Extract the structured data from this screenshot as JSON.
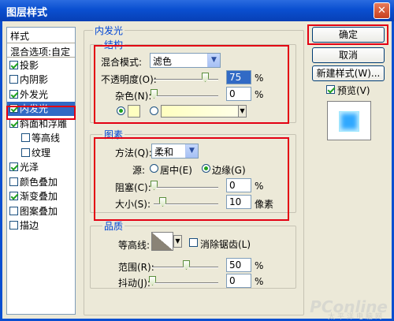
{
  "window": {
    "title": "图层样式",
    "close_glyph": "✕"
  },
  "sidebar": {
    "header": "样式",
    "blend_options": "混合选项:自定",
    "items": [
      {
        "label": "投影",
        "checked": true,
        "sub": false,
        "selected": false
      },
      {
        "label": "内阴影",
        "checked": false,
        "sub": false,
        "selected": false
      },
      {
        "label": "外发光",
        "checked": true,
        "sub": false,
        "selected": false
      },
      {
        "label": "内发光",
        "checked": true,
        "sub": false,
        "selected": true
      },
      {
        "label": "斜面和浮雕",
        "checked": true,
        "sub": false,
        "selected": false
      },
      {
        "label": "等高线",
        "checked": false,
        "sub": true,
        "selected": false
      },
      {
        "label": "纹理",
        "checked": false,
        "sub": true,
        "selected": false
      },
      {
        "label": "光泽",
        "checked": true,
        "sub": false,
        "selected": false
      },
      {
        "label": "颜色叠加",
        "checked": false,
        "sub": false,
        "selected": false
      },
      {
        "label": "渐变叠加",
        "checked": true,
        "sub": false,
        "selected": false
      },
      {
        "label": "图案叠加",
        "checked": false,
        "sub": false,
        "selected": false
      },
      {
        "label": "描边",
        "checked": false,
        "sub": false,
        "selected": false
      }
    ]
  },
  "panel": {
    "title": "内发光",
    "structure": {
      "title": "结构",
      "blend_mode_label": "混合模式:",
      "blend_mode_value": "滤色",
      "opacity_label": "不透明度(O):",
      "opacity_value": "75",
      "opacity_unit": "%",
      "opacity_level": 0.75,
      "noise_label": "杂色(N):",
      "noise_value": "0",
      "noise_unit": "%",
      "color_swatch": "#ffffc0"
    },
    "elements": {
      "title": "图素",
      "method_label": "方法(Q):",
      "method_value": "柔和",
      "source_label": "源:",
      "source_center": "居中(E)",
      "source_edge": "边缘(G)",
      "choke_label": "阻塞(C):",
      "choke_value": "0",
      "choke_unit": "%",
      "size_label": "大小(S):",
      "size_value": "10",
      "size_unit": "像素"
    },
    "quality": {
      "title": "品质",
      "contour_label": "等高线:",
      "antialias_label": "消除锯齿(L)",
      "range_label": "范围(R):",
      "range_value": "50",
      "range_unit": "%",
      "jitter_label": "抖动(J):",
      "jitter_value": "0",
      "jitter_unit": "%"
    }
  },
  "buttons": {
    "ok": "确定",
    "cancel": "取消",
    "new_style": "新建样式(W)...",
    "preview": "预览(V)"
  },
  "watermark": {
    "brand": "PConline",
    "sub": "太平洋电脑网"
  },
  "colors": {
    "highlight": "#e30013",
    "selection": "#316ac5",
    "preview_fill": "#30a8ff"
  }
}
